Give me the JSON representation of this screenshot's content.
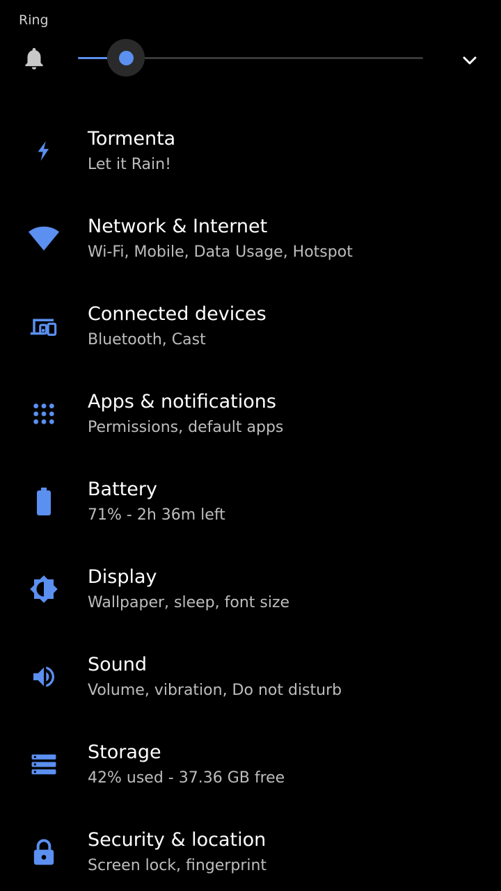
{
  "volume": {
    "label": "Ring",
    "level_percent": 14,
    "bell_icon": "bell-icon",
    "expand_icon": "chevron-down-icon"
  },
  "accent_color": "#5b8ff0",
  "settings": [
    {
      "title": "Tormenta",
      "subtitle": "Let it Rain!",
      "icon": "bolt-icon"
    },
    {
      "title": "Network & Internet",
      "subtitle": "Wi-Fi, Mobile, Data Usage, Hotspot",
      "icon": "wifi-icon"
    },
    {
      "title": "Connected devices",
      "subtitle": "Bluetooth, Cast",
      "icon": "devices-icon"
    },
    {
      "title": "Apps & notifications",
      "subtitle": "Permissions, default apps",
      "icon": "apps-grid-icon"
    },
    {
      "title": "Battery",
      "subtitle": "71% - 2h 36m left",
      "icon": "battery-icon"
    },
    {
      "title": "Display",
      "subtitle": "Wallpaper, sleep, font size",
      "icon": "brightness-icon"
    },
    {
      "title": "Sound",
      "subtitle": "Volume, vibration, Do not disturb",
      "icon": "speaker-icon"
    },
    {
      "title": "Storage",
      "subtitle": "42% used - 37.36 GB free",
      "icon": "storage-icon"
    },
    {
      "title": "Security & location",
      "subtitle": "Screen lock, fingerprint",
      "icon": "lock-icon"
    }
  ]
}
